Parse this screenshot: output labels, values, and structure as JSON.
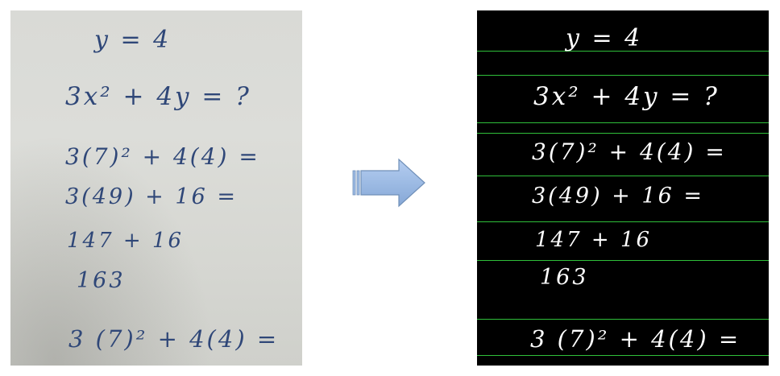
{
  "handwritten_work": {
    "line1": "y = 4",
    "line2": "3x² + 4y = ?",
    "line3": "3(7)² + 4(4) =",
    "line4": "3(49)  + 16 =",
    "line5": "147  + 16",
    "line6": "163",
    "line7": "3 (7)² + 4(4) ="
  },
  "colors": {
    "paper": "#d9dad6",
    "ink_blue": "#2f4778",
    "board_background": "#000000",
    "board_rule": "#2fbf3a",
    "board_ink": "#ffffff",
    "arrow_fill": "#9dbbe4",
    "arrow_stroke": "#6f8fb8"
  },
  "icons": {
    "transition": "right-arrow-icon"
  }
}
